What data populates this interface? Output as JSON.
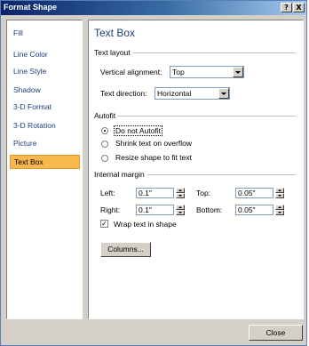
{
  "window": {
    "title": "Format Shape",
    "help_button": "?",
    "close_button": "X"
  },
  "sidebar": {
    "items": [
      {
        "label": "Fill"
      },
      {
        "label": "Line Color"
      },
      {
        "label": "Line Style"
      },
      {
        "label": "Shadow"
      },
      {
        "label": "3-D Format"
      },
      {
        "label": "3-D Rotation"
      },
      {
        "label": "Picture"
      },
      {
        "label": "Text Box",
        "selected": true
      }
    ]
  },
  "main": {
    "title": "Text Box",
    "text_layout": {
      "group_label": "Text layout",
      "vertical_alignment": {
        "label": "Vertical alignment:",
        "value": "Top"
      },
      "text_direction": {
        "label": "Text direction:",
        "value": "Horizontal"
      }
    },
    "autofit": {
      "group_label": "Autofit",
      "options": [
        {
          "label": "Do not Autofit",
          "checked": true
        },
        {
          "label": "Shrink text on overflow",
          "checked": false
        },
        {
          "label": "Resize shape to fit text",
          "checked": false
        }
      ]
    },
    "internal_margin": {
      "group_label": "Internal margin",
      "left": {
        "label": "Left:",
        "value": "0.1\""
      },
      "top": {
        "label": "Top:",
        "value": "0.05\""
      },
      "right": {
        "label": "Right:",
        "value": "0.1\""
      },
      "bottom": {
        "label": "Bottom:",
        "value": "0.05\""
      },
      "wrap_text": {
        "label": "Wrap text in shape",
        "checked": true,
        "mark": "✓"
      },
      "columns_button": "Columns..."
    }
  },
  "footer": {
    "close_button": "Close"
  },
  "colors": {
    "title_bar": "#0a246a",
    "dialog_face": "#d4d0c8",
    "selected_item": "#f9b84e",
    "nav_text": "#1f3d7a"
  }
}
